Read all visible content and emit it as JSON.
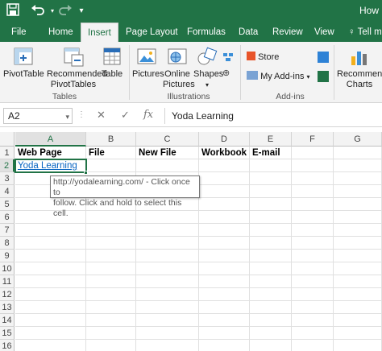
{
  "window": {
    "title": "How"
  },
  "quick_access": {
    "save_icon": "save-icon",
    "undo_icon": "undo-icon",
    "redo_icon": "redo-icon",
    "customize_icon": "customize-qat-icon"
  },
  "tabs": [
    {
      "label": "File"
    },
    {
      "label": "Home"
    },
    {
      "label": "Insert"
    },
    {
      "label": "Page Layout"
    },
    {
      "label": "Formulas"
    },
    {
      "label": "Data"
    },
    {
      "label": "Review"
    },
    {
      "label": "View"
    },
    {
      "label": "Tell m"
    }
  ],
  "ribbon": {
    "pivottable": "PivotTable",
    "recommended_pivottables_1": "Recommended",
    "recommended_pivottables_2": "PivotTables",
    "table": "Table",
    "group_tables": "Tables",
    "pictures": "Pictures",
    "online_pictures_1": "Online",
    "online_pictures_2": "Pictures",
    "shapes": "Shapes",
    "group_illustrations": "Illustrations",
    "store": "Store",
    "my_addins": "My Add-ins",
    "group_addins": "Add-ins",
    "recommended_charts_1": "Recommende",
    "recommended_charts_2": "Charts"
  },
  "formula_bar": {
    "name_box": "A2",
    "cancel": "✕",
    "enter": "✓",
    "fx": "fx",
    "formula": "Yoda Learning"
  },
  "columns": [
    "A",
    "B",
    "C",
    "D",
    "E",
    "F",
    "G"
  ],
  "rows": [
    "1",
    "2",
    "3",
    "4",
    "5",
    "6",
    "7",
    "8",
    "9",
    "10",
    "11",
    "12",
    "13",
    "14",
    "15",
    "16"
  ],
  "cells": {
    "A1": "Web Page",
    "B1": "File",
    "C1": "New File",
    "D1": "Workbook",
    "E1": "E-mail",
    "A2": "Yoda Learning"
  },
  "tooltip": {
    "line1": "http://yodalearning.com/ - Click once to",
    "line2": "follow. Click and hold to select this cell."
  },
  "colors": {
    "excel_green": "#217346",
    "link": "#0563c1"
  }
}
